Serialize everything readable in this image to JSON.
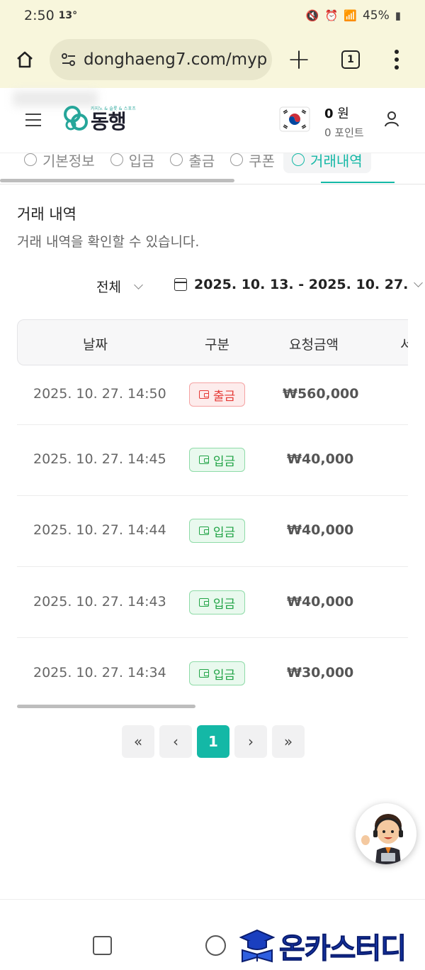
{
  "status_bar": {
    "time": "2:50",
    "temp": "13°",
    "battery": "45%"
  },
  "browser": {
    "url": "donghaeng7.com/myp",
    "tab_count": "1"
  },
  "header": {
    "logo_small": "카지노 & 슬롯 & 스포츠",
    "logo_text": "동행",
    "balance_amount": "0",
    "balance_unit": "원",
    "points": "0 포인트"
  },
  "tabs": [
    {
      "label": "기본정보"
    },
    {
      "label": "입금"
    },
    {
      "label": "출금"
    },
    {
      "label": "쿠폰"
    },
    {
      "label": "거래내역",
      "active": true
    }
  ],
  "page": {
    "title": "거래 내역",
    "description": "거래 내역을 확인할 수 있습니다."
  },
  "filters": {
    "type": "전체",
    "date_range": "2025. 10. 13. - 2025. 10. 27."
  },
  "table": {
    "headers": [
      "날짜",
      "구분",
      "요청금액",
      "서"
    ],
    "rows": [
      {
        "date": "2025. 10. 27. 14:50",
        "type": "출금",
        "kind": "out",
        "amount": "₩560,000"
      },
      {
        "date": "2025. 10. 27. 14:45",
        "type": "입금",
        "kind": "in",
        "amount": "₩40,000"
      },
      {
        "date": "2025. 10. 27. 14:44",
        "type": "입금",
        "kind": "in",
        "amount": "₩40,000"
      },
      {
        "date": "2025. 10. 27. 14:43",
        "type": "입금",
        "kind": "in",
        "amount": "₩40,000"
      },
      {
        "date": "2025. 10. 27. 14:34",
        "type": "입금",
        "kind": "in",
        "amount": "₩30,000"
      }
    ]
  },
  "pagination": {
    "first": "«",
    "prev": "‹",
    "current": "1",
    "next": "›",
    "last": "»"
  },
  "watermark": "온카스터디",
  "colors": {
    "accent": "#14b8a6",
    "out": "#e53935",
    "in": "#22a447",
    "browser_bg": "#f8f6dc"
  }
}
